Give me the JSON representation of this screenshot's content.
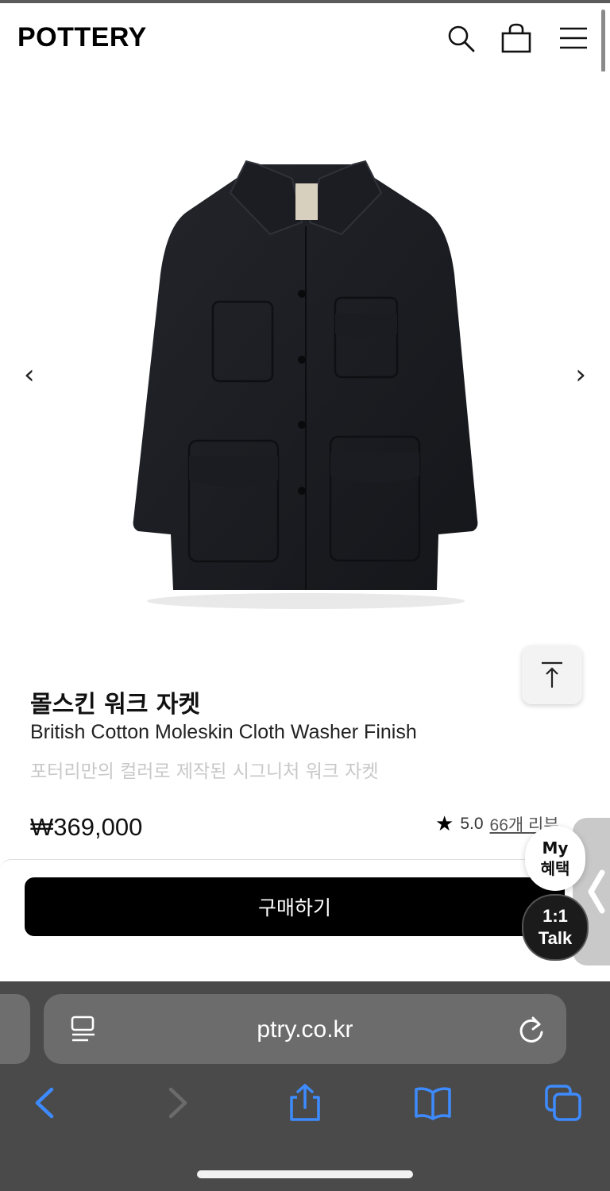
{
  "header": {
    "logo": "POTTERY",
    "icons": [
      "search-icon",
      "shopping-bag-icon",
      "menu-icon"
    ]
  },
  "gallery": {
    "image_alt": "몰스킨 워크 자켓",
    "prev_arrow": "‹",
    "next_arrow": "›"
  },
  "product": {
    "title": "몰스킨 워크 자켓",
    "subtitle": "British Cotton Moleskin Cloth Washer Finish",
    "description": "포터리만의 컬러로 제작된 시그니처 워크 자켓",
    "price": "₩369,000",
    "rating": "5.0",
    "reviews": "66개 리뷰"
  },
  "actions": {
    "buy_label": "구매하기",
    "my_benefit_line1": "My",
    "my_benefit_line2": "혜택",
    "talk_line1": "1:1",
    "talk_line2": "Talk"
  },
  "browser": {
    "url": "ptry.co.kr"
  },
  "colors": {
    "accent_blue": "#3d8bff",
    "buy_button": "#000000",
    "browser_bar": "#4a4a4a"
  }
}
